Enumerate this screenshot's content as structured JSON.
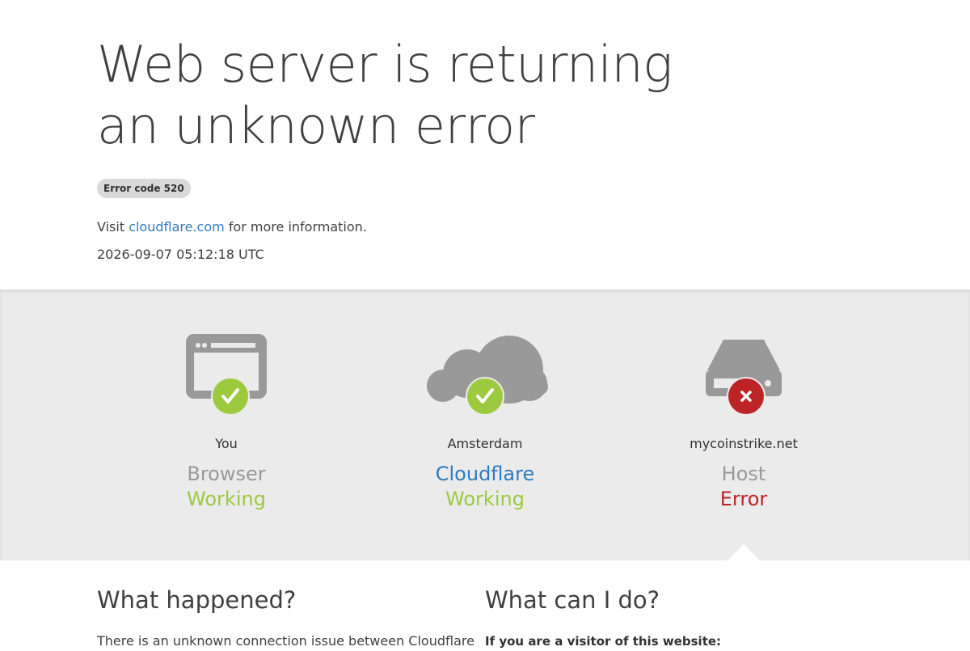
{
  "page": {
    "title": "Web server is returning an unknown error",
    "error_badge": "Error code 520",
    "visit_prefix": "Visit",
    "visit_link": "cloudflare.com",
    "visit_suffix": "for more information.",
    "timestamp": "2026-09-07 05:12:18 UTC"
  },
  "status": [
    {
      "location": "You",
      "role": "Browser",
      "state": "Working",
      "icon": "browser-icon",
      "badge_icon": "check-icon"
    },
    {
      "location": "Amsterdam",
      "role": "Cloudflare",
      "state": "Working",
      "icon": "cloud-icon",
      "badge_icon": "check-icon"
    },
    {
      "location": "mycoinstrike.net",
      "role": "Host",
      "state": "Error",
      "icon": "server-icon",
      "badge_icon": "x-icon"
    }
  ],
  "colors": {
    "ok": "#9bca3e",
    "error": "#bd2426",
    "link": "#2f7bbf",
    "icon_gray": "#999999"
  },
  "info": {
    "what_happened": {
      "heading": "What happened?",
      "text": "There is an unknown connection issue between Cloudflare"
    },
    "what_can_i_do": {
      "heading": "What can I do?",
      "text": "If you are a visitor of this website:"
    }
  }
}
